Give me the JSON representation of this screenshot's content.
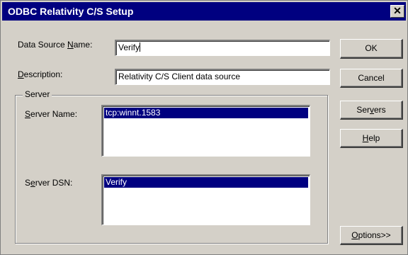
{
  "window": {
    "title": "ODBC Relativity C/S Setup",
    "close_glyph": "✕"
  },
  "fields": {
    "dsn": {
      "label_pre": "Data Source ",
      "label_ul": "N",
      "label_post": "ame:",
      "value": "Verify"
    },
    "description": {
      "label_pre": "",
      "label_ul": "D",
      "label_post": "escription:",
      "value": "Relativity C/S Client data source"
    }
  },
  "server": {
    "group_label": "Server",
    "name": {
      "label_pre": "",
      "label_ul": "S",
      "label_post": "erver Name:",
      "selected": "tcp:winnt.1583"
    },
    "dsn": {
      "label_pre": "S",
      "label_ul": "e",
      "label_post": "rver DSN:",
      "selected": "Verify"
    }
  },
  "buttons": {
    "ok": {
      "pre": "OK",
      "ul": "",
      "post": ""
    },
    "cancel": {
      "pre": "Cancel",
      "ul": "",
      "post": ""
    },
    "servers": {
      "pre": "Ser",
      "ul": "v",
      "post": "ers"
    },
    "help": {
      "pre": "",
      "ul": "H",
      "post": "elp"
    },
    "options": {
      "pre": "",
      "ul": "O",
      "post": "ptions>>"
    }
  },
  "colors": {
    "face": "#d4d0c8",
    "title_bar": "#000080",
    "selection": "#000080"
  }
}
